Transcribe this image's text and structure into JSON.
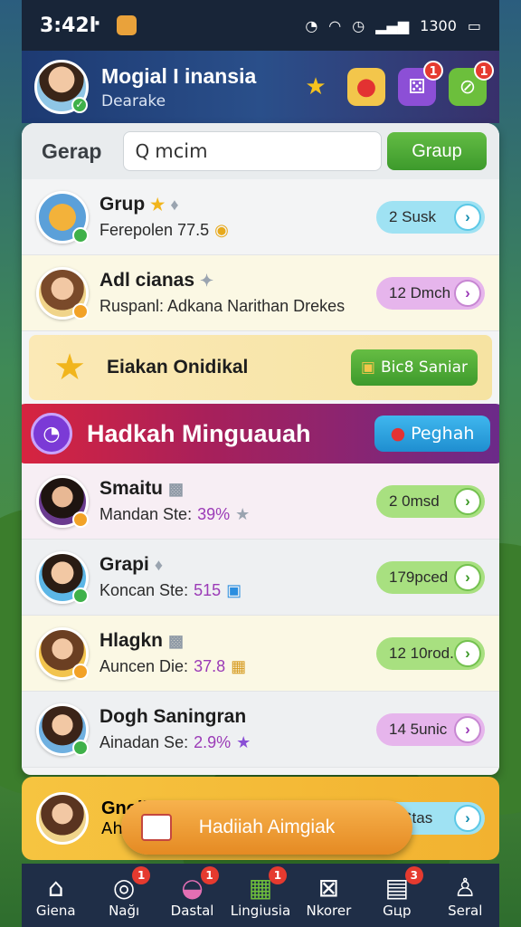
{
  "status_bar": {
    "time": "3:42ŀ",
    "battery_text": "1300"
  },
  "header": {
    "name": "Mogial I inansia",
    "subtitle": "Dearake",
    "badge_counts": [
      "1",
      "1"
    ]
  },
  "search_bar": {
    "title": "Gerap",
    "search_value": "mcim",
    "button_label": "Graup"
  },
  "rows": [
    {
      "title": "Grup",
      "subtitle": "Ferepolen 77.5",
      "pill_label": "2 Susk",
      "pill_color": "blue"
    },
    {
      "title": "Adl cianas",
      "subtitle": "Ruspanl: Adkana Narithan Drekes",
      "pill_label": "12 Dmch",
      "pill_color": "pink"
    }
  ],
  "favorite_row": {
    "title": "Eiakan Onidikal",
    "button_label": "Bic8 Saniar"
  },
  "promo": {
    "title": "Hadkah Minguauah",
    "button_label": "Peghah"
  },
  "list": [
    {
      "name": "Smaitu",
      "detail_prefix": "Mandan Ste:",
      "detail_value": "39%",
      "pill_label": "2 0msd",
      "pill_color": "green"
    },
    {
      "name": "Grapi",
      "detail_prefix": "Koncan Ste:",
      "detail_value": "515",
      "pill_label": "179pced",
      "pill_color": "green"
    },
    {
      "name": "Hlagkn",
      "detail_prefix": "Auncen Die:",
      "detail_value": "37.8",
      "pill_label": "12 10rod.",
      "pill_color": "green"
    },
    {
      "name": "Dogh Saningran",
      "detail_prefix": "Ainadan Se:",
      "detail_value": "2.9%",
      "pill_label": "14 5unic",
      "pill_color": "pink"
    }
  ],
  "last_card": {
    "title": "Gnoih",
    "subtitle": "Ah",
    "pill_label": "9 Stas"
  },
  "floating_button": {
    "label": "Hadiiah Aimgiak"
  },
  "bottom_nav": [
    {
      "label": "Giena",
      "icon": "home-icon",
      "badge": ""
    },
    {
      "label": "Nağı",
      "icon": "ball-icon",
      "badge": "1"
    },
    {
      "label": "Dastal",
      "icon": "pot-icon",
      "badge": "1"
    },
    {
      "label": "Lingiusia",
      "icon": "gift-icon",
      "badge": "1"
    },
    {
      "label": "Nkorer",
      "icon": "box-icon",
      "badge": ""
    },
    {
      "label": "Gцр",
      "icon": "console-icon",
      "badge": "3"
    },
    {
      "label": "Seral",
      "icon": "user-icon",
      "badge": ""
    }
  ],
  "colors": {
    "accent_green": "#4fab35",
    "accent_blue": "#2aa4e0",
    "promo_red": "#d8243f",
    "promo_purple": "#6a2a8a"
  }
}
